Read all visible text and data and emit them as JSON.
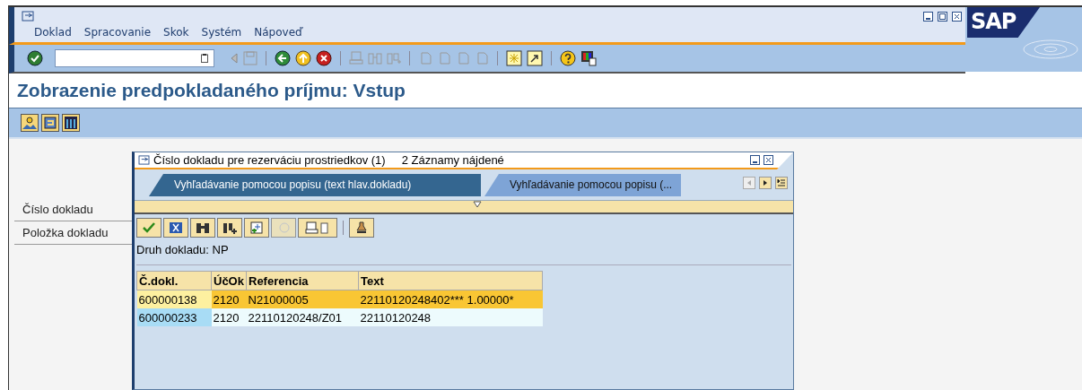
{
  "menu": [
    {
      "label": "Doklad"
    },
    {
      "label": "Spracovanie"
    },
    {
      "label": "Skok"
    },
    {
      "label": "Systém"
    },
    {
      "label": "Nápoveď"
    }
  ],
  "logo": "SAP",
  "screen_title": "Zobrazenie predpokladaného príjmu: Vstup",
  "fields": [
    {
      "label": "Číslo dokladu"
    },
    {
      "label": "Položka dokladu"
    }
  ],
  "dialog": {
    "title": "Číslo dokladu pre rezerváciu prostriedkov (1)",
    "hits": "2 Záznamy nájdené",
    "tabs": [
      {
        "label": "Vyhľadávanie pomocou popisu (text hlav.dokladu)",
        "selected": true
      },
      {
        "label": "Vyhľadávanie pomocou popisu (...",
        "selected": false
      }
    ],
    "info": "Druh dokladu: NP",
    "table": {
      "columns": [
        "Č.dokl.",
        "ÚčOk",
        "Referencia",
        "Text"
      ],
      "rows": [
        {
          "cells": [
            "600000138",
            "2120",
            "N21000005",
            "22110120248402***  1.00000*"
          ],
          "selected": true
        },
        {
          "cells": [
            "600000233",
            "2120",
            "22110120248/Z01",
            "22110120248"
          ],
          "selected": false
        }
      ]
    }
  }
}
